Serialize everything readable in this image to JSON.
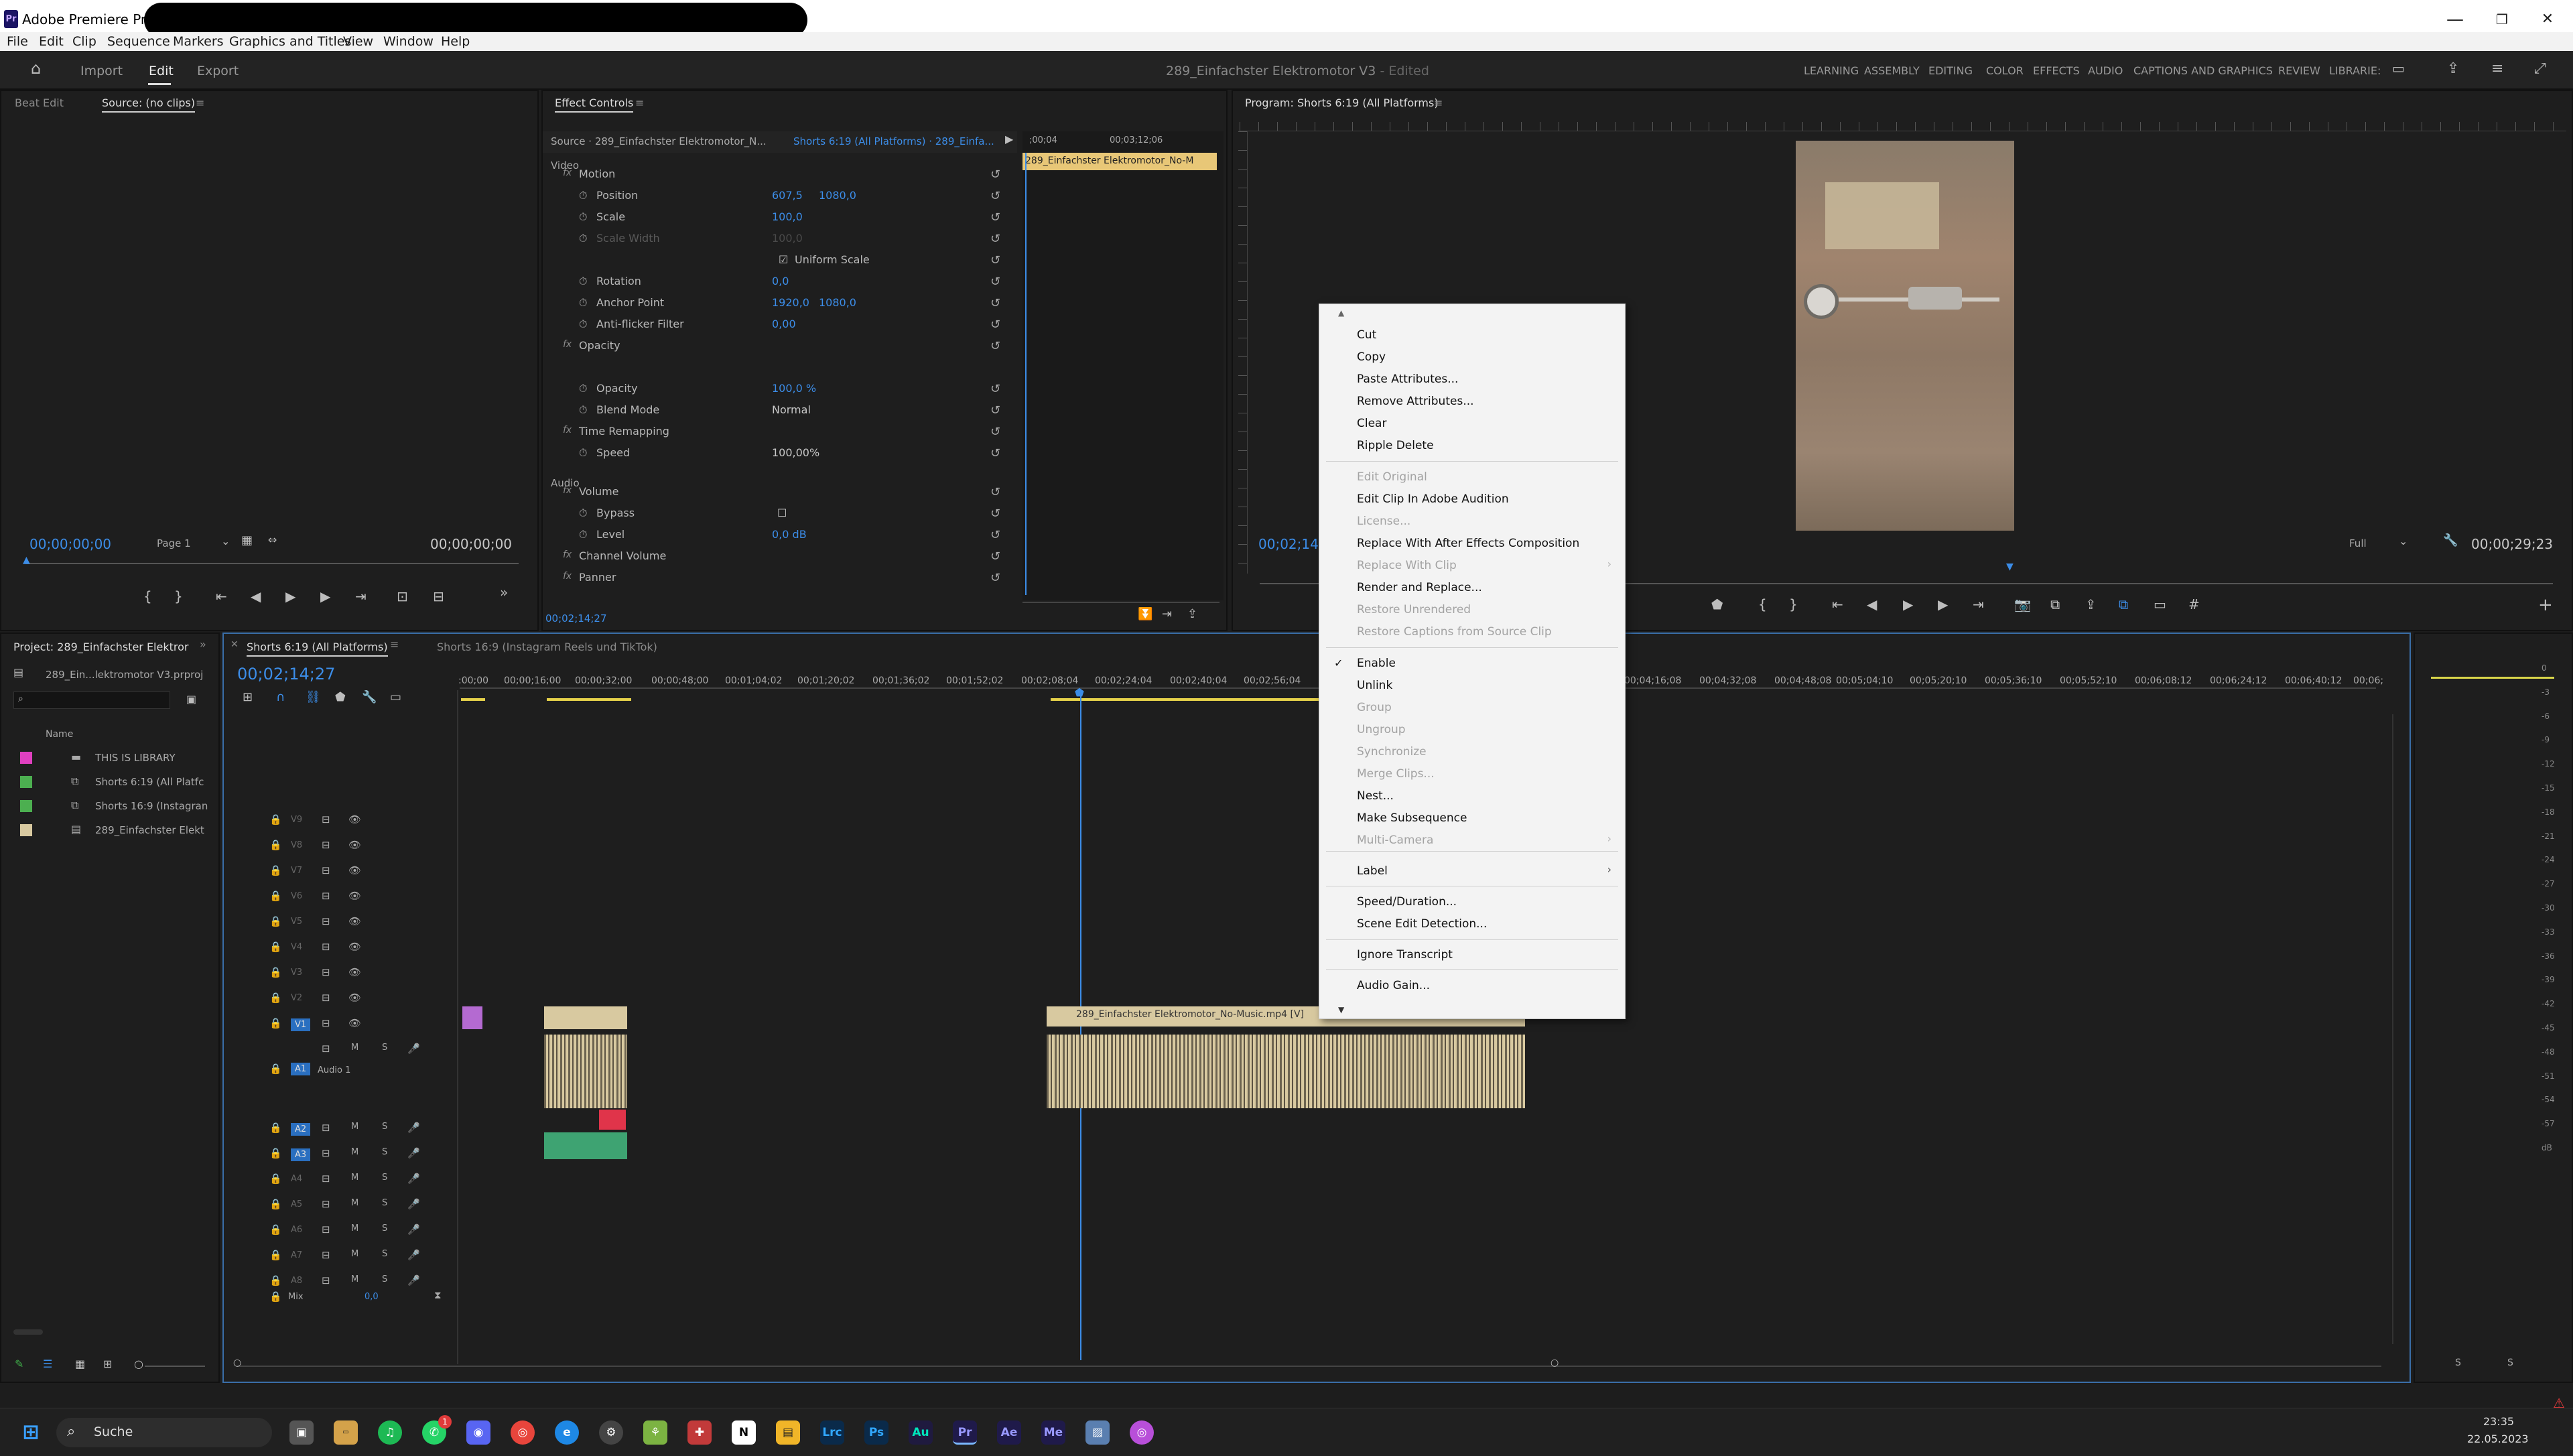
{
  "window": {
    "app_title": "Adobe Premiere Pro 2023",
    "minimize": "—",
    "maximize": "❐",
    "close": "✕"
  },
  "menu": [
    "File",
    "Edit",
    "Clip",
    "Sequence",
    "Markers",
    "Graphics and Titles",
    "View",
    "Window",
    "Help"
  ],
  "header": {
    "tabs": [
      "Import",
      "Edit",
      "Export"
    ],
    "project_title": "289_Einfachster Elektromotor V3",
    "edited": "- Edited",
    "workspaces": [
      "LEARNING",
      "ASSEMBLY",
      "EDITING",
      "COLOR",
      "EFFECTS",
      "AUDIO",
      "CAPTIONS AND GRAPHICS",
      "REVIEW",
      "LIBRARIE:"
    ]
  },
  "source_panel": {
    "tabs": [
      "Beat Edit",
      "Source: (no clips)"
    ],
    "timecode_left": "00;00;00;00",
    "page": "Page 1",
    "timecode_right": "00;00;00;00"
  },
  "effect_controls": {
    "tab": "Effect Controls",
    "source": "Source · 289_Einfachster Elektromotor_N...",
    "sequence": "Shorts 6:19 (All Platforms) · 289_Einfa...",
    "ruler_left": ";00;04",
    "ruler_right": "00;03;12;06",
    "clip_name": "289_Einfachster Elektromotor_No-M",
    "sections": {
      "video": "Video",
      "audio": "Audio"
    },
    "rows": [
      {
        "label": "Motion",
        "v1": "",
        "v2": ""
      },
      {
        "label": "Position",
        "v1": "607,5",
        "v2": "1080,0"
      },
      {
        "label": "Scale",
        "v1": "100,0",
        "v2": ""
      },
      {
        "label": "Scale Width",
        "v1": "100,0",
        "v2": ""
      },
      {
        "label": "Uniform Scale",
        "v1": "",
        "v2": ""
      },
      {
        "label": "Rotation",
        "v1": "0,0",
        "v2": ""
      },
      {
        "label": "Anchor Point",
        "v1": "1920,0",
        "v2": "1080,0"
      },
      {
        "label": "Anti-flicker Filter",
        "v1": "0,00",
        "v2": ""
      },
      {
        "label": "Opacity",
        "v1": "",
        "v2": ""
      },
      {
        "label": "Opacity",
        "v1": "100,0 %",
        "v2": ""
      },
      {
        "label": "Blend Mode",
        "v1": "Normal",
        "v2": ""
      },
      {
        "label": "Time Remapping",
        "v1": "",
        "v2": ""
      },
      {
        "label": "Speed",
        "v1": "100,00%",
        "v2": ""
      },
      {
        "label": "Volume",
        "v1": "",
        "v2": ""
      },
      {
        "label": "Bypass",
        "v1": "",
        "v2": ""
      },
      {
        "label": "Level",
        "v1": "0,0 dB",
        "v2": ""
      },
      {
        "label": "Channel Volume",
        "v1": "",
        "v2": ""
      },
      {
        "label": "Panner",
        "v1": "",
        "v2": ""
      }
    ],
    "timecode": "00;02;14;27"
  },
  "program": {
    "tab": "Program: Shorts 6:19 (All Platforms)",
    "timecode_left": "00;02;14;",
    "fit": "Full",
    "timecode_right": "00;00;29;23"
  },
  "project": {
    "tab": "Project: 289_Einfachster Elektror",
    "file": "289_Ein...lektromotor V3.prproj",
    "col_name": "Name",
    "items": [
      {
        "name": "THIS IS LIBRARY",
        "color": "#e040c0"
      },
      {
        "name": "Shorts 6:19 (All Platfc",
        "color": "#4caf50"
      },
      {
        "name": "Shorts 16:9 (Instagran",
        "color": "#4caf50"
      },
      {
        "name": "289_Einfachster Elekt",
        "color": "#d8c9a0"
      }
    ]
  },
  "timeline": {
    "tabs": [
      "Shorts 6:19 (All Platforms)",
      "Shorts 16:9 (Instagram Reels und TikTok)"
    ],
    "timecode": "00;02;14;27",
    "ruler": [
      ":00;00",
      "00;00;16;00",
      "00;00;32;00",
      "00;00;48;00",
      "00;01;04;02",
      "00;01;20;02",
      "00;01;36;02",
      "00;01;52;02",
      "00;02;08;04",
      "00;02;24;04",
      "00;02;40;04",
      "00;02;56;04",
      "00;04;16;08",
      "00;04;32;08",
      "00;04;48;08",
      "00;05;04;10",
      "00;05;20;10",
      "00;05;36;10",
      "00;05;52;10",
      "00;06;08;12",
      "00;06;24;12",
      "00;06;40;12",
      "00;06;"
    ],
    "video_tracks": [
      "V9",
      "V8",
      "V7",
      "V6",
      "V5",
      "V4",
      "V3",
      "V2",
      "V1"
    ],
    "audio_tracks": [
      "A1",
      "A2",
      "A3",
      "A4",
      "A5",
      "A6",
      "A7",
      "A8"
    ],
    "audio1_name": "Audio 1",
    "mix_label": "Mix",
    "mix_value": "0,0",
    "clip_v_name": "289_Einfachster Elektromotor_No-Music.mp4 [V]",
    "track_btn_m": "M",
    "track_btn_s": "S"
  },
  "context_menu": {
    "items": [
      {
        "label": "Cut",
        "disabled": false
      },
      {
        "label": "Copy",
        "disabled": false
      },
      {
        "label": "Paste Attributes...",
        "disabled": false
      },
      {
        "label": "Remove Attributes...",
        "disabled": false
      },
      {
        "label": "Clear",
        "disabled": false
      },
      {
        "label": "Ripple Delete",
        "disabled": false
      },
      {
        "label": "Edit Original",
        "disabled": true
      },
      {
        "label": "Edit Clip In Adobe Audition",
        "disabled": false
      },
      {
        "label": "License...",
        "disabled": true
      },
      {
        "label": "Replace With After Effects Composition",
        "disabled": false
      },
      {
        "label": "Replace With Clip",
        "disabled": true
      },
      {
        "label": "Render and Replace...",
        "disabled": false
      },
      {
        "label": "Restore Unrendered",
        "disabled": true
      },
      {
        "label": "Restore Captions from Source Clip",
        "disabled": true
      },
      {
        "label": "Enable",
        "disabled": false,
        "checked": true
      },
      {
        "label": "Unlink",
        "disabled": false
      },
      {
        "label": "Group",
        "disabled": true
      },
      {
        "label": "Ungroup",
        "disabled": true
      },
      {
        "label": "Synchronize",
        "disabled": true
      },
      {
        "label": "Merge Clips...",
        "disabled": true
      },
      {
        "label": "Nest...",
        "disabled": false
      },
      {
        "label": "Make Subsequence",
        "disabled": false
      },
      {
        "label": "Multi-Camera",
        "disabled": true
      },
      {
        "label": "Label",
        "disabled": false
      },
      {
        "label": "Speed/Duration...",
        "disabled": false
      },
      {
        "label": "Scene Edit Detection...",
        "disabled": false
      },
      {
        "label": "Ignore Transcript",
        "disabled": false
      },
      {
        "label": "Audio Gain...",
        "disabled": false
      }
    ],
    "scroll_up": "▲",
    "scroll_down": "▼",
    "check": "✓",
    "submenu_arrow": "›"
  },
  "audio_meter": {
    "labels": [
      "0",
      "-3",
      "-6",
      "-9",
      "-12",
      "-15",
      "-18",
      "-21",
      "-24",
      "-27",
      "-30",
      "-33",
      "-36",
      "-39",
      "-42",
      "-45",
      "-48",
      "-51",
      "-54",
      "-57",
      "dB"
    ],
    "solo_left": "S",
    "solo_right": "S"
  },
  "taskbar": {
    "search_placeholder": "Suche",
    "time": "23:35",
    "date": "22.05.2023",
    "apps": [
      {
        "label": "Lrc",
        "color": "#0a2a4a"
      },
      {
        "label": "Ps",
        "color": "#0a2a4a"
      },
      {
        "label": "Au",
        "color": "#1f1a3f"
      },
      {
        "label": "Pr",
        "color": "#1f1a4a"
      },
      {
        "label": "Ae",
        "color": "#1f1a4a"
      },
      {
        "label": "Me",
        "color": "#1f1a4a"
      }
    ],
    "whatsapp_badge": "1"
  }
}
